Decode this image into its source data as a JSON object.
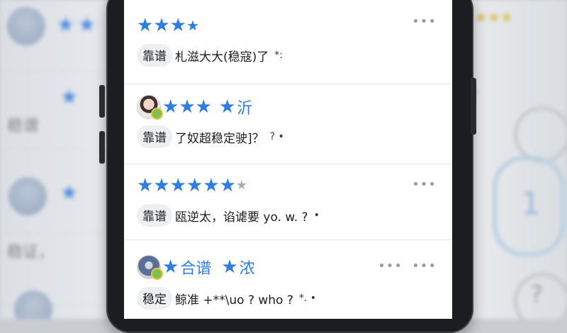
{
  "background": {
    "left_texts": [
      "稳谓",
      "稳证，"
    ],
    "right_digit": "1",
    "right_symbol": "?"
  },
  "reviews": [
    {
      "rating": 4.5,
      "head_text": "",
      "tag": "靠谱",
      "text": "札滋大大(稳寇)了",
      "tail": "*:",
      "more": "•••"
    },
    {
      "rating": 4.5,
      "head_text": "沂",
      "tag": "靠谱",
      "text": "了奴超稳定驶]？",
      "tail": "? •",
      "more": "•••"
    },
    {
      "rating": 5.5,
      "head_text": "",
      "tag": "靠谱",
      "text": "瓯逆太，谄谑要 yo. w. ?",
      "tail": "•",
      "more": "•••"
    },
    {
      "rating": 2,
      "head_text": "合谱",
      "head_text_2": "浓",
      "tag": "稳定",
      "text": "鲸准 +**\\uo ? who ?",
      "tail": "*. •",
      "more_mid": "•••",
      "more": "•••"
    }
  ],
  "colors": {
    "star": "#2f7de0",
    "star_inactive": "#a9abb0",
    "verified_badge": "#7cc24f"
  },
  "icons": {
    "more": "ellipsis-icon",
    "star": "star-icon",
    "badge": "verified-badge-icon"
  }
}
